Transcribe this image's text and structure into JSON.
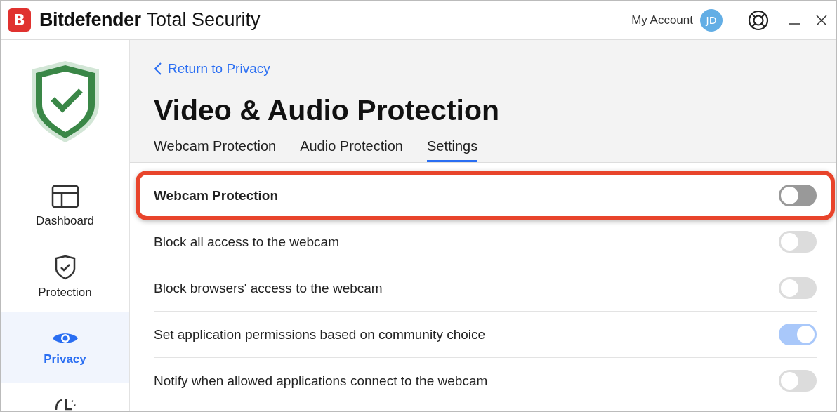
{
  "window": {
    "logo_letter": "B",
    "brand": "Bitdefender",
    "product": "Total Security",
    "account_label": "My Account",
    "avatar_initials": "JD"
  },
  "sidebar": {
    "items": [
      {
        "label": "Dashboard",
        "kind": "dashboard",
        "selected": false
      },
      {
        "label": "Protection",
        "kind": "protection",
        "selected": false
      },
      {
        "label": "Privacy",
        "kind": "privacy",
        "selected": true
      },
      {
        "kind": "utilities",
        "selected": false
      }
    ]
  },
  "back_link": "Return to Privacy",
  "title": "Video & Audio Protection",
  "tabs": [
    {
      "label": "Webcam Protection",
      "selected": false
    },
    {
      "label": "Audio Protection",
      "selected": false
    },
    {
      "label": "Settings",
      "selected": true
    }
  ],
  "settings": [
    {
      "label": "Webcam Protection",
      "kind": "master",
      "on": false,
      "disabled": false,
      "highlighted": true
    },
    {
      "label": "Block all access to the webcam",
      "kind": "option",
      "on": false,
      "disabled": true,
      "highlighted": false
    },
    {
      "label": "Block browsers' access to the webcam",
      "kind": "option",
      "on": false,
      "disabled": true,
      "highlighted": false
    },
    {
      "label": "Set application permissions based on community choice",
      "kind": "option",
      "on": true,
      "disabled": true,
      "highlighted": false
    },
    {
      "label": "Notify when allowed applications connect to the webcam",
      "kind": "option",
      "on": false,
      "disabled": true,
      "highlighted": false
    }
  ]
}
